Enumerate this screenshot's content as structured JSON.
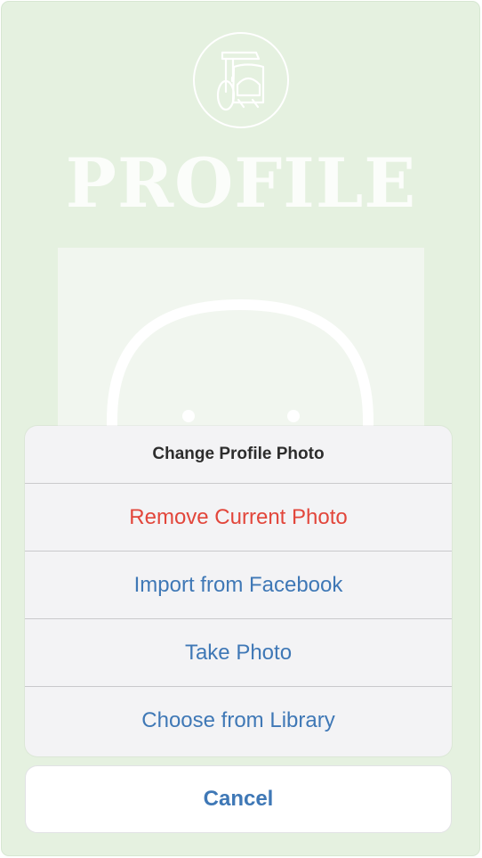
{
  "app": {
    "page_title": "PROFILE",
    "logo_icon": "coffee-cart-logo-icon",
    "avatar_icon": "avatar-placeholder-icon"
  },
  "action_sheet": {
    "title": "Change Profile Photo",
    "actions": [
      {
        "label": "Remove Current Photo",
        "style": "destructive"
      },
      {
        "label": "Import from Facebook",
        "style": "default"
      },
      {
        "label": "Take Photo",
        "style": "default"
      },
      {
        "label": "Choose from Library",
        "style": "default"
      }
    ],
    "cancel_label": "Cancel"
  },
  "colors": {
    "background_green": "#e3f0de",
    "action_blue": "#3f78b6",
    "destructive_red": "#e2463b",
    "sheet_gray": "#f3f3f5"
  }
}
